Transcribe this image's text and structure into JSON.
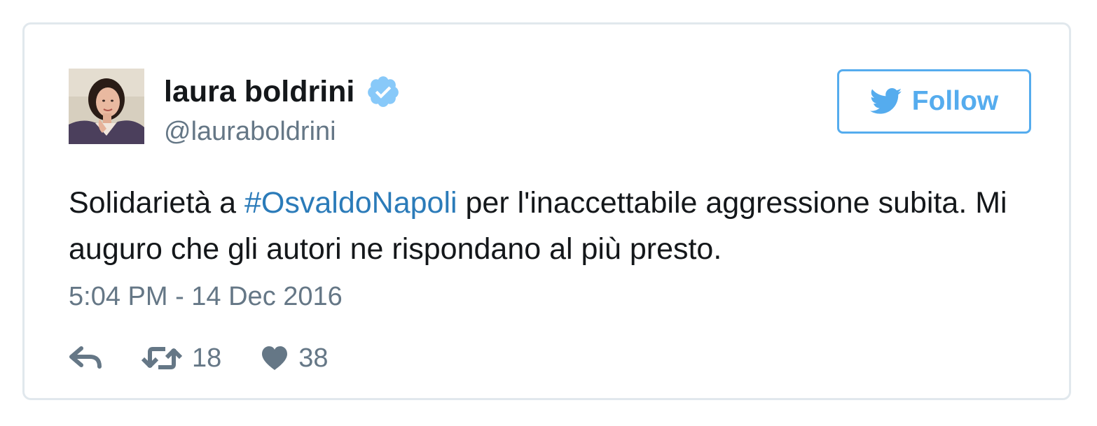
{
  "user": {
    "display_name": "laura boldrini",
    "handle": "@lauraboldrini",
    "verified": true
  },
  "follow_button": {
    "label": "Follow",
    "icon": "twitter-bird-icon"
  },
  "tweet": {
    "text_before": "Solidarietà a ",
    "hashtag": "#OsvaldoNapoli",
    "text_after": " per l'inaccettabile aggressione subita. Mi auguro che gli autori ne rispondano al più presto.",
    "timestamp": "5:04 PM - 14 Dec 2016"
  },
  "actions": {
    "reply_icon": "reply-icon",
    "retweet_icon": "retweet-icon",
    "retweet_count": "18",
    "like_icon": "heart-icon",
    "like_count": "38"
  },
  "colors": {
    "accent": "#55acee",
    "link": "#2b7bb9",
    "text": "#14171a",
    "muted": "#657786",
    "border": "#e1e8ed",
    "verified": "#88c9f9"
  }
}
